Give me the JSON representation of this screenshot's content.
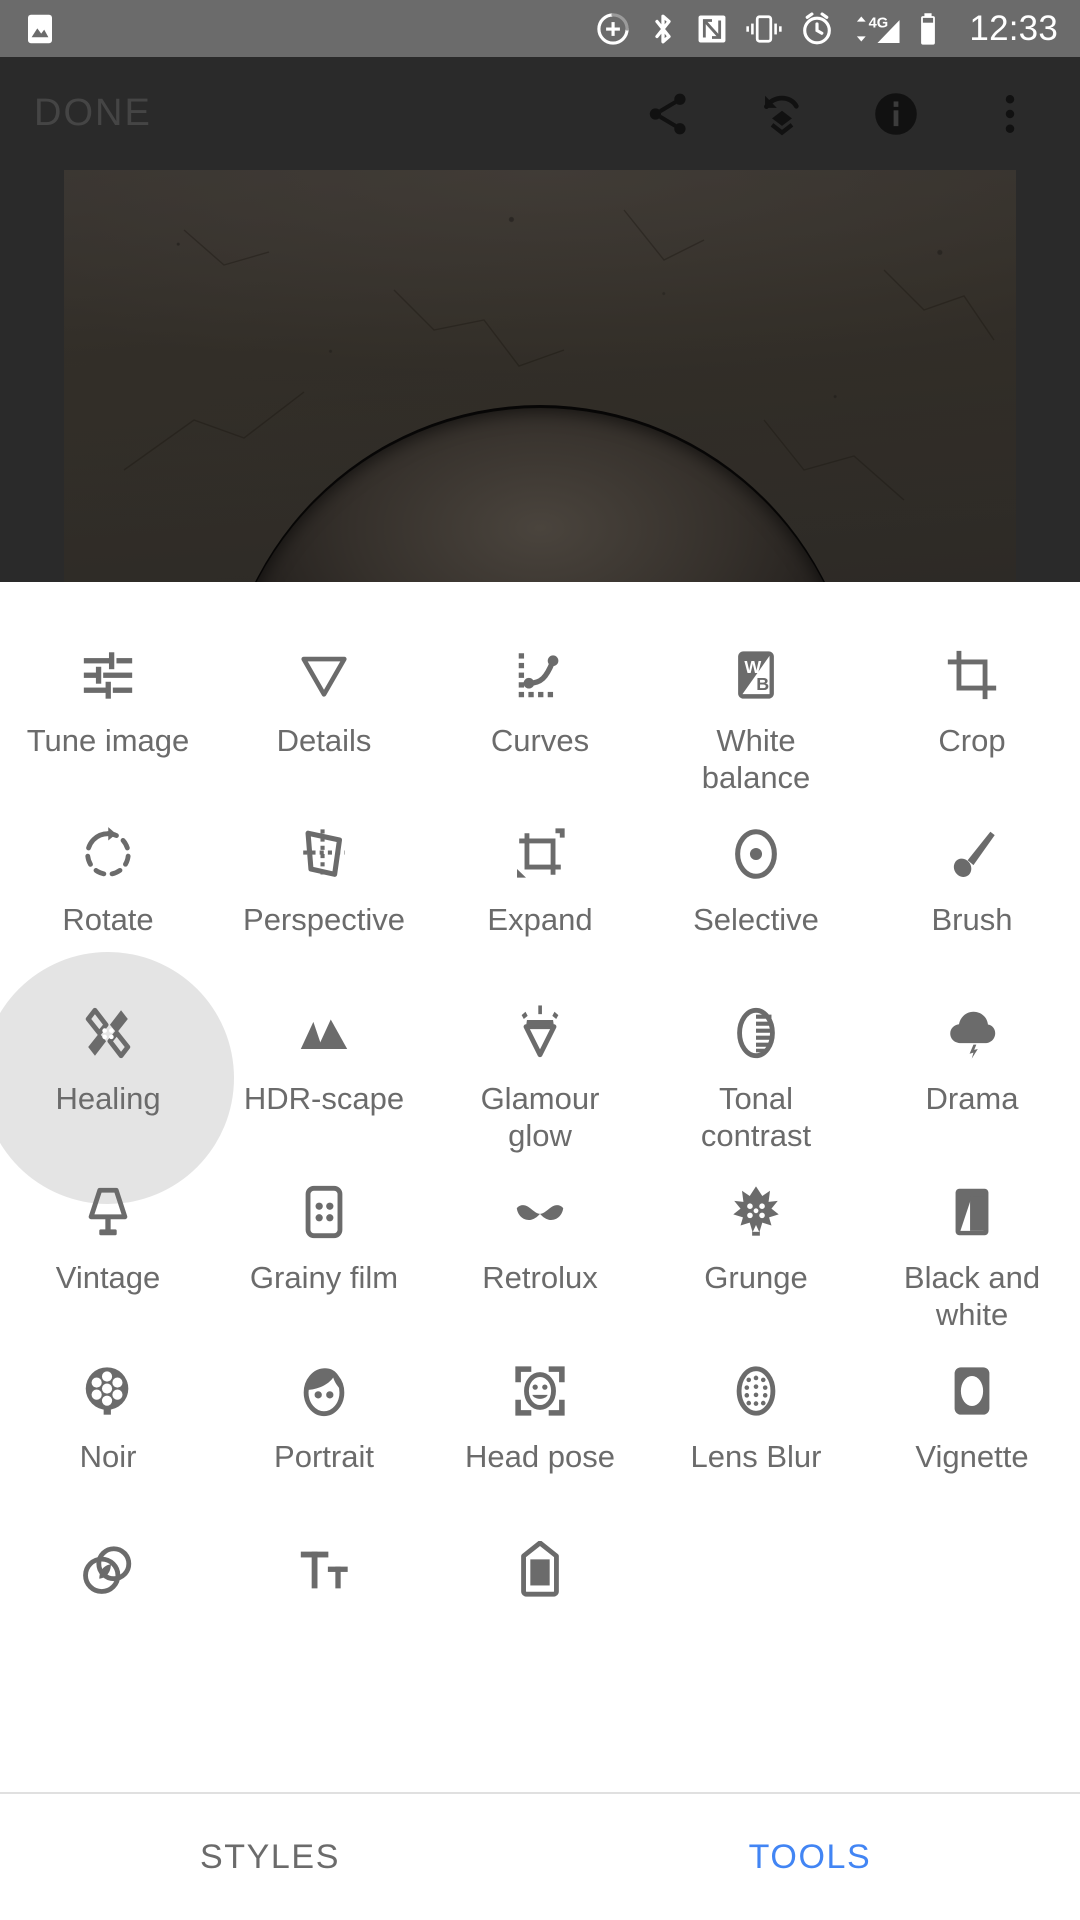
{
  "status_bar": {
    "time": "12:33",
    "icons": [
      {
        "name": "photo-notification-icon",
        "glyph": "image"
      },
      {
        "name": "battery-saver-plus-icon",
        "glyph": "plus-circle"
      },
      {
        "name": "bluetooth-icon",
        "glyph": "bluetooth"
      },
      {
        "name": "nfc-icon",
        "glyph": "nfc"
      },
      {
        "name": "vibrate-icon",
        "glyph": "vibrate"
      },
      {
        "name": "alarm-icon",
        "glyph": "alarm"
      },
      {
        "name": "mobile-data-4g-icon",
        "glyph": "4g",
        "label": "4G"
      },
      {
        "name": "signal-bars-icon",
        "glyph": "signal"
      },
      {
        "name": "battery-icon",
        "glyph": "battery"
      }
    ],
    "background_color": "#6b6b6b",
    "foreground_color": "#ffffff"
  },
  "editor": {
    "done_label": "DONE",
    "actions": [
      {
        "name": "share-button",
        "icon": "share-icon"
      },
      {
        "name": "undo-stack-button",
        "icon": "undo-layers-icon"
      },
      {
        "name": "info-button",
        "icon": "info-icon"
      },
      {
        "name": "overflow-menu-button",
        "icon": "more-vert-icon"
      }
    ],
    "background_color": "#2a2a2a",
    "done_color": "#454545"
  },
  "tools": {
    "accent_color": "#4285f4",
    "label_color": "#6b6b6b",
    "ripple_color": "#e4e4e4",
    "selected": "Healing",
    "items": [
      {
        "label": "Tune image",
        "icon": "tune-sliders-icon",
        "selected": false
      },
      {
        "label": "Details",
        "icon": "details-triangle-icon",
        "selected": false
      },
      {
        "label": "Curves",
        "icon": "curves-icon",
        "selected": false
      },
      {
        "label": "White balance",
        "icon": "white-balance-icon",
        "selected": false
      },
      {
        "label": "Crop",
        "icon": "crop-icon",
        "selected": false
      },
      {
        "label": "Rotate",
        "icon": "rotate-icon",
        "selected": false
      },
      {
        "label": "Perspective",
        "icon": "perspective-icon",
        "selected": false
      },
      {
        "label": "Expand",
        "icon": "expand-icon",
        "selected": false
      },
      {
        "label": "Selective",
        "icon": "selective-icon",
        "selected": false
      },
      {
        "label": "Brush",
        "icon": "brush-icon",
        "selected": false
      },
      {
        "label": "Healing",
        "icon": "healing-bandage-icon",
        "selected": true
      },
      {
        "label": "HDR-scape",
        "icon": "hdr-mountains-icon",
        "selected": false
      },
      {
        "label": "Glamour glow",
        "icon": "glamour-glow-icon",
        "selected": false
      },
      {
        "label": "Tonal contrast",
        "icon": "tonal-contrast-icon",
        "selected": false
      },
      {
        "label": "Drama",
        "icon": "drama-cloud-icon",
        "selected": false
      },
      {
        "label": "Vintage",
        "icon": "vintage-lamp-icon",
        "selected": false
      },
      {
        "label": "Grainy film",
        "icon": "grainy-film-icon",
        "selected": false
      },
      {
        "label": "Retrolux",
        "icon": "retrolux-mustache-icon",
        "selected": false
      },
      {
        "label": "Grunge",
        "icon": "grunge-icon",
        "selected": false
      },
      {
        "label": "Black and white",
        "icon": "black-and-white-icon",
        "selected": false
      },
      {
        "label": "Noir",
        "icon": "noir-film-reel-icon",
        "selected": false
      },
      {
        "label": "Portrait",
        "icon": "portrait-face-icon",
        "selected": false
      },
      {
        "label": "Head pose",
        "icon": "head-pose-icon",
        "selected": false
      },
      {
        "label": "Lens Blur",
        "icon": "lens-blur-icon",
        "selected": false
      },
      {
        "label": "Vignette",
        "icon": "vignette-icon",
        "selected": false
      },
      {
        "label": "",
        "icon": "double-exposure-icon",
        "selected": false
      },
      {
        "label": "",
        "icon": "text-icon",
        "selected": false
      },
      {
        "label": "",
        "icon": "frames-icon",
        "selected": false
      }
    ]
  },
  "tab_bar": {
    "tabs": [
      {
        "label": "STYLES",
        "active": false
      },
      {
        "label": "TOOLS",
        "active": true
      }
    ]
  }
}
